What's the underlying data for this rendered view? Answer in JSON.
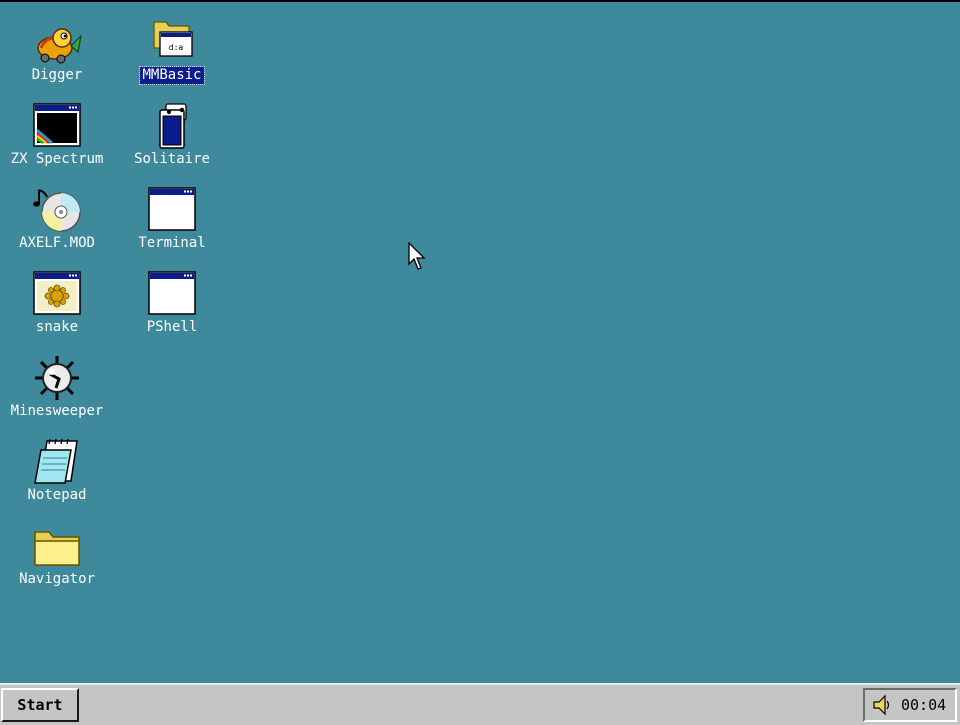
{
  "desktop": {
    "background": "#3e899c",
    "icons": [
      {
        "label": "Digger",
        "icon": "digger-icon"
      },
      {
        "label": "ZX Spectrum",
        "icon": "zx-spectrum-icon"
      },
      {
        "label": "AXELF.MOD",
        "icon": "music-cd-icon"
      },
      {
        "label": "snake",
        "icon": "snake-icon"
      },
      {
        "label": "Minesweeper",
        "icon": "mine-icon"
      },
      {
        "label": "Notepad",
        "icon": "notepad-icon"
      },
      {
        "label": "Navigator",
        "icon": "folder-icon"
      },
      {
        "label": "MMBasic",
        "icon": "mmbasic-icon",
        "selected": true
      },
      {
        "label": "Solitaire",
        "icon": "cards-icon"
      },
      {
        "label": "Terminal",
        "icon": "window-icon"
      },
      {
        "label": "PShell",
        "icon": "window-icon"
      }
    ]
  },
  "taskbar": {
    "start_label": "Start",
    "clock": "00:04",
    "volume_icon": "speaker-icon"
  },
  "colors": {
    "taskbar": "#c5c5c5",
    "selection": "#0b1d8a"
  }
}
